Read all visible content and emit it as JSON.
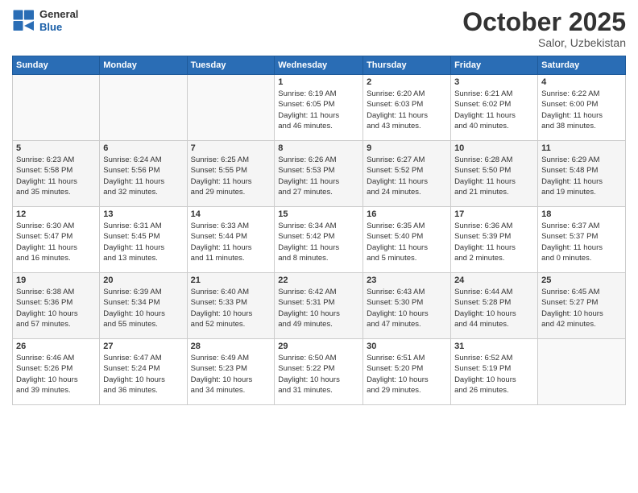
{
  "logo": {
    "general": "General",
    "blue": "Blue"
  },
  "header": {
    "month": "October 2025",
    "location": "Salor, Uzbekistan"
  },
  "weekdays": [
    "Sunday",
    "Monday",
    "Tuesday",
    "Wednesday",
    "Thursday",
    "Friday",
    "Saturday"
  ],
  "weeks": [
    [
      {
        "day": "",
        "info": ""
      },
      {
        "day": "",
        "info": ""
      },
      {
        "day": "",
        "info": ""
      },
      {
        "day": "1",
        "info": "Sunrise: 6:19 AM\nSunset: 6:05 PM\nDaylight: 11 hours\nand 46 minutes."
      },
      {
        "day": "2",
        "info": "Sunrise: 6:20 AM\nSunset: 6:03 PM\nDaylight: 11 hours\nand 43 minutes."
      },
      {
        "day": "3",
        "info": "Sunrise: 6:21 AM\nSunset: 6:02 PM\nDaylight: 11 hours\nand 40 minutes."
      },
      {
        "day": "4",
        "info": "Sunrise: 6:22 AM\nSunset: 6:00 PM\nDaylight: 11 hours\nand 38 minutes."
      }
    ],
    [
      {
        "day": "5",
        "info": "Sunrise: 6:23 AM\nSunset: 5:58 PM\nDaylight: 11 hours\nand 35 minutes."
      },
      {
        "day": "6",
        "info": "Sunrise: 6:24 AM\nSunset: 5:56 PM\nDaylight: 11 hours\nand 32 minutes."
      },
      {
        "day": "7",
        "info": "Sunrise: 6:25 AM\nSunset: 5:55 PM\nDaylight: 11 hours\nand 29 minutes."
      },
      {
        "day": "8",
        "info": "Sunrise: 6:26 AM\nSunset: 5:53 PM\nDaylight: 11 hours\nand 27 minutes."
      },
      {
        "day": "9",
        "info": "Sunrise: 6:27 AM\nSunset: 5:52 PM\nDaylight: 11 hours\nand 24 minutes."
      },
      {
        "day": "10",
        "info": "Sunrise: 6:28 AM\nSunset: 5:50 PM\nDaylight: 11 hours\nand 21 minutes."
      },
      {
        "day": "11",
        "info": "Sunrise: 6:29 AM\nSunset: 5:48 PM\nDaylight: 11 hours\nand 19 minutes."
      }
    ],
    [
      {
        "day": "12",
        "info": "Sunrise: 6:30 AM\nSunset: 5:47 PM\nDaylight: 11 hours\nand 16 minutes."
      },
      {
        "day": "13",
        "info": "Sunrise: 6:31 AM\nSunset: 5:45 PM\nDaylight: 11 hours\nand 13 minutes."
      },
      {
        "day": "14",
        "info": "Sunrise: 6:33 AM\nSunset: 5:44 PM\nDaylight: 11 hours\nand 11 minutes."
      },
      {
        "day": "15",
        "info": "Sunrise: 6:34 AM\nSunset: 5:42 PM\nDaylight: 11 hours\nand 8 minutes."
      },
      {
        "day": "16",
        "info": "Sunrise: 6:35 AM\nSunset: 5:40 PM\nDaylight: 11 hours\nand 5 minutes."
      },
      {
        "day": "17",
        "info": "Sunrise: 6:36 AM\nSunset: 5:39 PM\nDaylight: 11 hours\nand 2 minutes."
      },
      {
        "day": "18",
        "info": "Sunrise: 6:37 AM\nSunset: 5:37 PM\nDaylight: 11 hours\nand 0 minutes."
      }
    ],
    [
      {
        "day": "19",
        "info": "Sunrise: 6:38 AM\nSunset: 5:36 PM\nDaylight: 10 hours\nand 57 minutes."
      },
      {
        "day": "20",
        "info": "Sunrise: 6:39 AM\nSunset: 5:34 PM\nDaylight: 10 hours\nand 55 minutes."
      },
      {
        "day": "21",
        "info": "Sunrise: 6:40 AM\nSunset: 5:33 PM\nDaylight: 10 hours\nand 52 minutes."
      },
      {
        "day": "22",
        "info": "Sunrise: 6:42 AM\nSunset: 5:31 PM\nDaylight: 10 hours\nand 49 minutes."
      },
      {
        "day": "23",
        "info": "Sunrise: 6:43 AM\nSunset: 5:30 PM\nDaylight: 10 hours\nand 47 minutes."
      },
      {
        "day": "24",
        "info": "Sunrise: 6:44 AM\nSunset: 5:28 PM\nDaylight: 10 hours\nand 44 minutes."
      },
      {
        "day": "25",
        "info": "Sunrise: 6:45 AM\nSunset: 5:27 PM\nDaylight: 10 hours\nand 42 minutes."
      }
    ],
    [
      {
        "day": "26",
        "info": "Sunrise: 6:46 AM\nSunset: 5:26 PM\nDaylight: 10 hours\nand 39 minutes."
      },
      {
        "day": "27",
        "info": "Sunrise: 6:47 AM\nSunset: 5:24 PM\nDaylight: 10 hours\nand 36 minutes."
      },
      {
        "day": "28",
        "info": "Sunrise: 6:49 AM\nSunset: 5:23 PM\nDaylight: 10 hours\nand 34 minutes."
      },
      {
        "day": "29",
        "info": "Sunrise: 6:50 AM\nSunset: 5:22 PM\nDaylight: 10 hours\nand 31 minutes."
      },
      {
        "day": "30",
        "info": "Sunrise: 6:51 AM\nSunset: 5:20 PM\nDaylight: 10 hours\nand 29 minutes."
      },
      {
        "day": "31",
        "info": "Sunrise: 6:52 AM\nSunset: 5:19 PM\nDaylight: 10 hours\nand 26 minutes."
      },
      {
        "day": "",
        "info": ""
      }
    ]
  ]
}
